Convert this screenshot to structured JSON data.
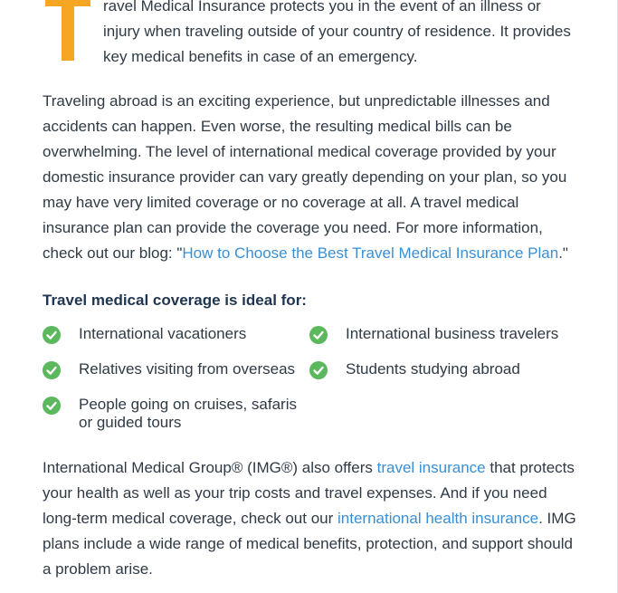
{
  "intro": {
    "dropcap": "T",
    "text": "ravel Medical Insurance protects you in the event of an illness or injury when traveling outside of your country of residence. It provides key medical benefits in case of an emergency."
  },
  "paragraph2": {
    "text": "Traveling abroad is an exciting experience, but unpredictable illnesses and accidents can happen. Even worse, the resulting medical bills can be overwhelming. The level of international medical coverage provided by your domestic insurance provider can vary greatly depending on your plan, so you may have very limited coverage or no coverage at all. A travel medical insurance plan can provide the coverage you need. For more information, check out our blog: \"",
    "link_text": "How to Choose the Best Travel Medical Insurance Plan",
    "text_after": ".\""
  },
  "coverage": {
    "heading": "Travel medical coverage is ideal for:",
    "items": [
      {
        "label": "International vacationers"
      },
      {
        "label": "International business travelers"
      },
      {
        "label": "Relatives visiting from overseas"
      },
      {
        "label": "Students studying abroad"
      },
      {
        "label": "People going on cruises, safaris or guided tours"
      }
    ]
  },
  "paragraph3": {
    "text1": "International Medical Group® (IMG®) also offers ",
    "link1": "travel insurance",
    "text2": " that protects your health as well as your trip costs and travel expenses. And if you need long-term medical coverage, check out our ",
    "link2": "international health insurance",
    "text3": ". IMG plans include a wide range of medical benefits, protection, and support should a problem arise."
  },
  "colors": {
    "dropcap": "#f5a623",
    "check_green": "#5cb85c",
    "link_blue": "#3a8fd4",
    "body_text": "#2f3a45",
    "heading_text": "#1f3550"
  },
  "icons": {
    "check": "check-circle-icon"
  }
}
